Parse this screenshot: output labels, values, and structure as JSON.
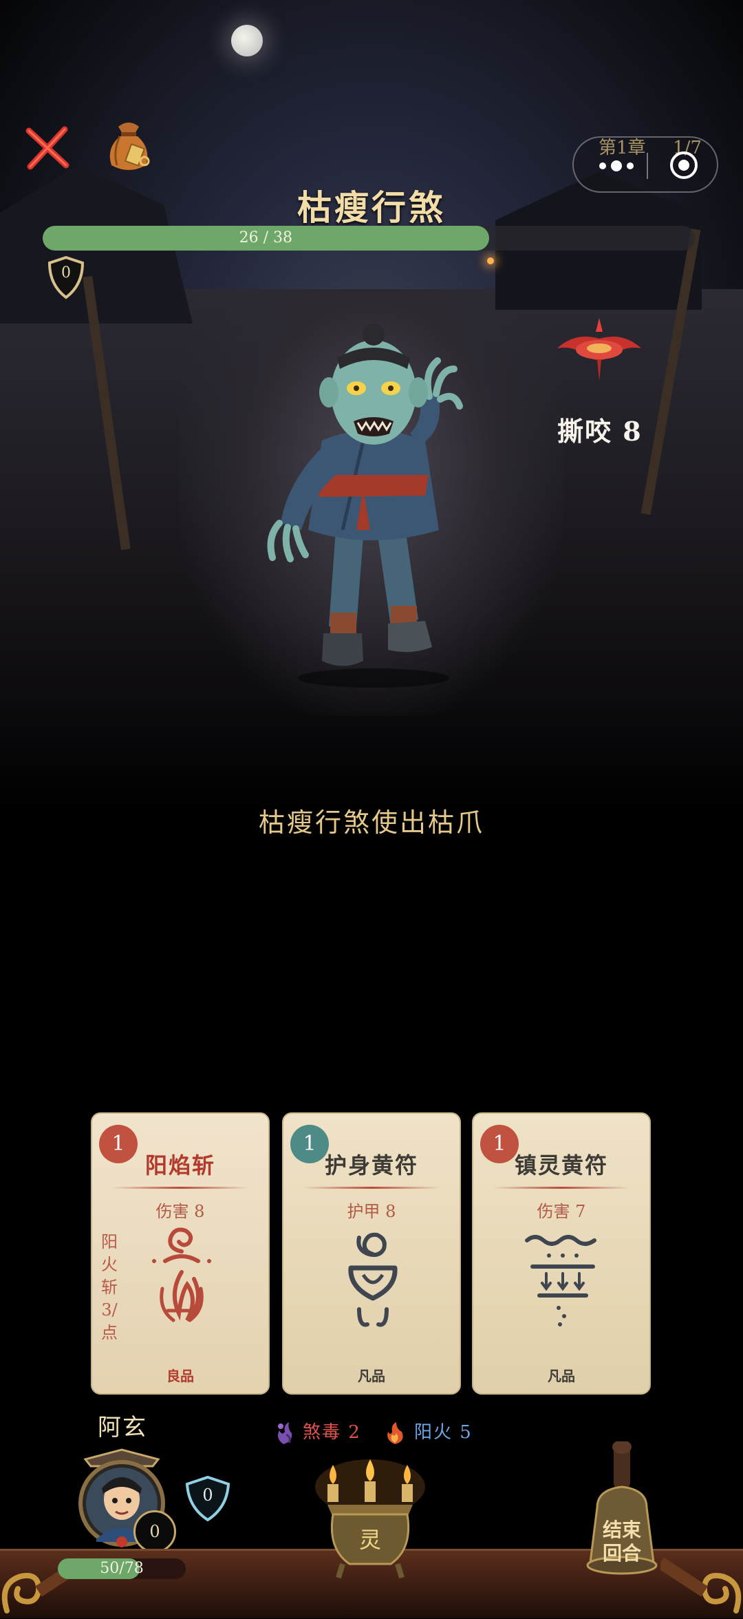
{
  "topbar": {
    "chapter_label": "第1章",
    "stage_progress": "1/7"
  },
  "enemy": {
    "name": "枯瘦行煞",
    "hp_text": "26 / 38",
    "hp_current": 26,
    "hp_max": 38,
    "block": "0",
    "intent": {
      "label": "撕咬 8",
      "icon": "red-lotus-attack-icon"
    }
  },
  "battle_log": "枯瘦行煞使出枯爪",
  "hand": [
    {
      "cost": "1",
      "name": "阳焰斩",
      "effect": "伤害 8",
      "note": "阳火斩3/点",
      "rarity": "良品",
      "cost_color": "#c0523f",
      "name_color": "#b23a2c",
      "rarity_color": "#b23a2c",
      "glyph": "fire-sigil-icon"
    },
    {
      "cost": "1",
      "name": "护身黄符",
      "effect": "护甲 8",
      "rarity": "凡品",
      "cost_color": "#4e8a86",
      "name_color": "#3e3a36",
      "rarity_color": "#3e3a36",
      "glyph": "ward-talisman-icon"
    },
    {
      "cost": "1",
      "name": "镇灵黄符",
      "effect": "伤害 7",
      "rarity": "凡品",
      "cost_color": "#c0523f",
      "name_color": "#3e3a36",
      "rarity_color": "#3e3a36",
      "glyph": "seal-talisman-icon"
    }
  ],
  "player": {
    "name": "阿玄",
    "block": "0",
    "shield": "0",
    "hp_text": "50/78",
    "hp_current": 50,
    "hp_max": 78
  },
  "statuses": [
    {
      "label": "煞毒 2",
      "icon": "poison-icon",
      "color": "#e2544a"
    },
    {
      "label": "阳火 5",
      "icon": "flame-icon",
      "color": "#6aa6e8"
    }
  ],
  "energy": {
    "label": "灵",
    "candles": 3
  },
  "end_turn": {
    "label_line1": "结束",
    "label_line2": "回合"
  }
}
